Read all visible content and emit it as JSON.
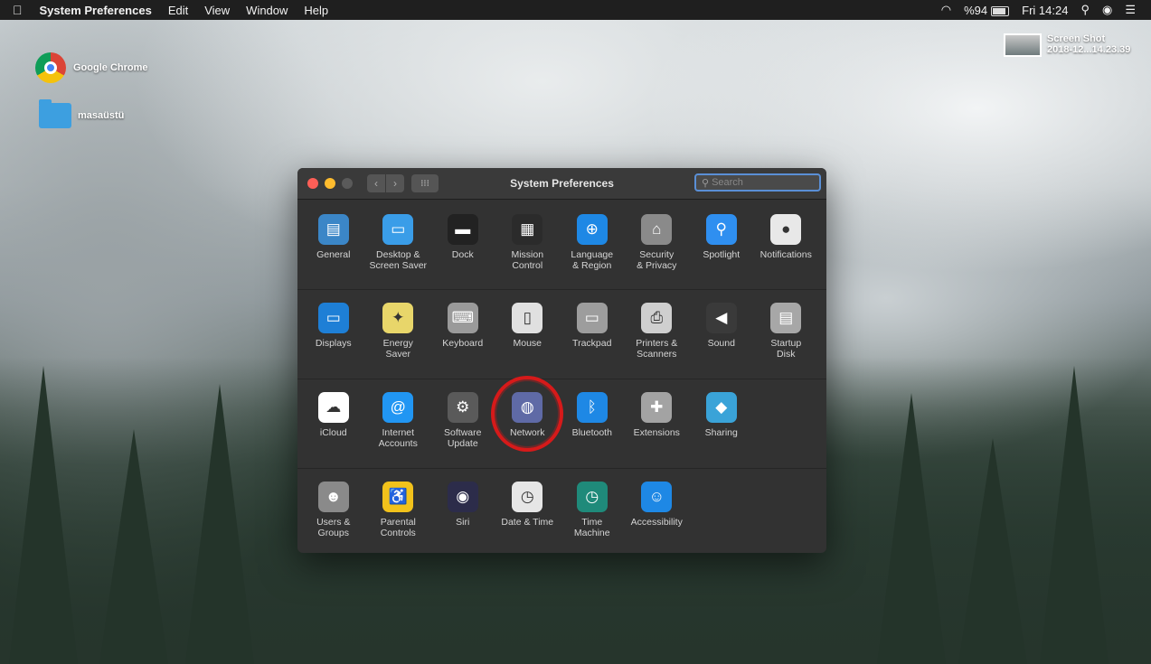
{
  "menubar": {
    "apple": "",
    "app": "System Preferences",
    "menus": [
      "Edit",
      "View",
      "Window",
      "Help"
    ],
    "battery_percent": "%94",
    "clock": "Fri 14:24"
  },
  "desktop": {
    "chrome_label": "Google Chrome",
    "folder_label": "masaüstü",
    "screenshot_line1": "Screen Shot",
    "screenshot_line2": "2018-12...14.23.39"
  },
  "window": {
    "title": "System Preferences",
    "search_placeholder": "Search",
    "nav_back": "‹",
    "nav_forward": "›",
    "grid": "⁝⁝⁝",
    "rows": [
      [
        {
          "label": "General",
          "icon": "general-icon",
          "glyph": "▤",
          "color": "#3b86c7"
        },
        {
          "label": "Desktop &\nScreen Saver",
          "icon": "desktop-icon",
          "glyph": "▭",
          "color": "#3a9de8"
        },
        {
          "label": "Dock",
          "icon": "dock-icon",
          "glyph": "▬",
          "color": "#222222"
        },
        {
          "label": "Mission\nControl",
          "icon": "mission-control-icon",
          "glyph": "▦",
          "color": "#2b2b2b"
        },
        {
          "label": "Language\n& Region",
          "icon": "globe-flag-icon",
          "glyph": "⊕",
          "color": "#1e88e5"
        },
        {
          "label": "Security\n& Privacy",
          "icon": "house-lock-icon",
          "glyph": "⌂",
          "color": "#8a8a8a"
        },
        {
          "label": "Spotlight",
          "icon": "spotlight-icon",
          "glyph": "⚲",
          "color": "#2f8ff0"
        },
        {
          "label": "Notifications",
          "icon": "notifications-icon",
          "glyph": "●",
          "color": "#e8e8e8"
        }
      ],
      [
        {
          "label": "Displays",
          "icon": "display-icon",
          "glyph": "▭",
          "color": "#1e7fd6"
        },
        {
          "label": "Energy\nSaver",
          "icon": "lightbulb-icon",
          "glyph": "✦",
          "color": "#e8d66a"
        },
        {
          "label": "Keyboard",
          "icon": "keyboard-icon",
          "glyph": "⌨",
          "color": "#9a9a9a"
        },
        {
          "label": "Mouse",
          "icon": "mouse-icon",
          "glyph": "▯",
          "color": "#e0e0e0"
        },
        {
          "label": "Trackpad",
          "icon": "trackpad-icon",
          "glyph": "▭",
          "color": "#9d9d9d"
        },
        {
          "label": "Printers &\nScanners",
          "icon": "printer-icon",
          "glyph": "⎙",
          "color": "#cfcfcf"
        },
        {
          "label": "Sound",
          "icon": "speaker-icon",
          "glyph": "◀",
          "color": "#3a3a3a"
        },
        {
          "label": "Startup\nDisk",
          "icon": "hard-disk-icon",
          "glyph": "▤",
          "color": "#a7a7a7"
        }
      ],
      [
        {
          "label": "iCloud",
          "icon": "icloud-icon",
          "glyph": "☁",
          "color": "#ffffff"
        },
        {
          "label": "Internet\nAccounts",
          "icon": "at-sign-icon",
          "glyph": "@",
          "color": "#2196f3"
        },
        {
          "label": "Software\nUpdate",
          "icon": "gear-icon",
          "glyph": "⚙",
          "color": "#5a5a5a"
        },
        {
          "label": "Network",
          "icon": "network-globe-icon",
          "glyph": "◍",
          "color": "#5f6aa6"
        },
        {
          "label": "Bluetooth",
          "icon": "bluetooth-icon",
          "glyph": "ᛒ",
          "color": "#1e88e5"
        },
        {
          "label": "Extensions",
          "icon": "puzzle-icon",
          "glyph": "✚",
          "color": "#a3a3a3"
        },
        {
          "label": "Sharing",
          "icon": "sharing-folder-icon",
          "glyph": "◆",
          "color": "#3aa3d8"
        }
      ],
      [
        {
          "label": "Users &\nGroups",
          "icon": "users-icon",
          "glyph": "☻",
          "color": "#8a8a8a"
        },
        {
          "label": "Parental\nControls",
          "icon": "parental-controls-icon",
          "glyph": "♿",
          "color": "#f2c21b"
        },
        {
          "label": "Siri",
          "icon": "siri-icon",
          "glyph": "◉",
          "color": "#2c2c4a"
        },
        {
          "label": "Date & Time",
          "icon": "clock-calendar-icon",
          "glyph": "◷",
          "color": "#e6e6e6"
        },
        {
          "label": "Time\nMachine",
          "icon": "time-machine-icon",
          "glyph": "◷",
          "color": "#1f8a7a"
        },
        {
          "label": "Accessibility",
          "icon": "accessibility-icon",
          "glyph": "☺",
          "color": "#1e88e5"
        }
      ]
    ]
  }
}
